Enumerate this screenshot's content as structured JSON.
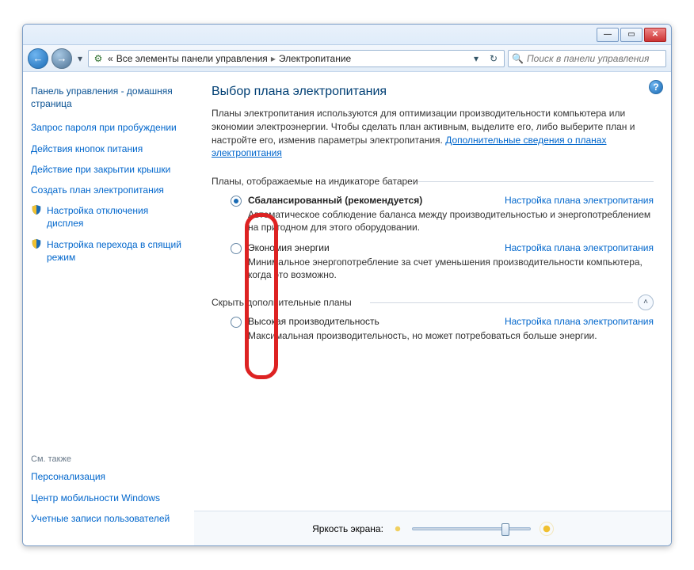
{
  "window": {
    "minimize_glyph": "—",
    "maximize_glyph": "▭",
    "close_glyph": "✕"
  },
  "nav": {
    "back_glyph": "←",
    "forward_glyph": "→",
    "dropdown_glyph": "▾",
    "path_prefix": "«",
    "path_seg1": "Все элементы панели управления",
    "path_sep": "▸",
    "path_seg2": "Электропитание",
    "addr_dd": "▾",
    "refresh_glyph": "↻"
  },
  "search": {
    "placeholder": "Поиск в панели управления"
  },
  "sidebar": {
    "home": "Панель управления - домашняя страница",
    "link_password": "Запрос пароля при пробуждении",
    "link_buttons": "Действия кнопок питания",
    "link_lid": "Действие при закрытии крышки",
    "link_create": "Создать план электропитания",
    "link_display": "Настройка отключения дисплея",
    "link_sleep": "Настройка перехода в спящий режим",
    "see_also_title": "См. также",
    "see_personalization": "Персонализация",
    "see_mobility": "Центр мобильности Windows",
    "see_accounts": "Учетные записи пользователей"
  },
  "main": {
    "help_glyph": "?",
    "title": "Выбор плана электропитания",
    "desc1": "Планы электропитания используются для оптимизации производительности компьютера или экономии электроэнергии. Чтобы сделать план активным, выделите его, либо выберите план и настройте его, изменив параметры электропитания. ",
    "desc_link": "Дополнительные сведения о планах электропитания",
    "group_battery": "Планы, отображаемые на индикаторе батареи",
    "group_hide": "Скрыть дополнительные планы",
    "collapse_glyph": "˄",
    "plan_link": "Настройка плана электропитания",
    "plans": [
      {
        "name": "Сбалансированный (рекомендуется)",
        "desc": "Автоматическое соблюдение баланса между производительностью и энергопотреблением на пригодном для этого оборудовании.",
        "checked": true,
        "bold": true
      },
      {
        "name": "Экономия энергии",
        "desc": "Минимальное энергопотребление за счет уменьшения производительности компьютера, когда это возможно.",
        "checked": false,
        "bold": false
      },
      {
        "name": "Высокая производительность",
        "desc": "Максимальная производительность, но может потребоваться больше энергии.",
        "checked": false,
        "bold": false
      }
    ],
    "brightness_label": "Яркость экрана:",
    "brightness_value_pct": 80
  }
}
